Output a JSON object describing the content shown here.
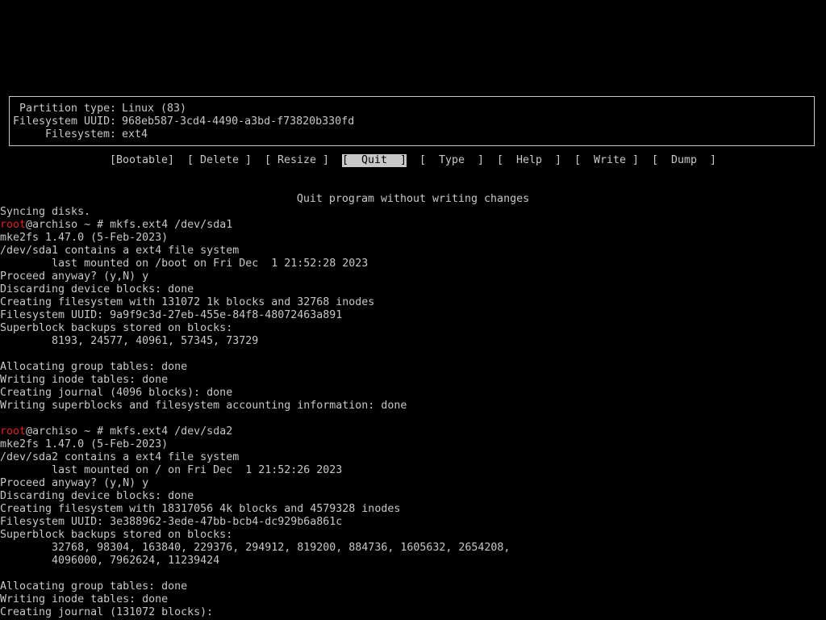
{
  "colors": {
    "background": "#000000",
    "text": "#c8c8c8",
    "prompt_user": "#e02020",
    "selected_bg": "#c8c8c8"
  },
  "partition_info": {
    "type_label": "Partition type:",
    "type_value": "Linux (83)",
    "uuid_label": "Filesystem UUID:",
    "uuid_value": "968eb587-3cd4-4490-a3bd-f73820b330fd",
    "fs_label": "Filesystem:",
    "fs_value": "ext4"
  },
  "menu": {
    "bootable": "[Bootable]",
    "delete": "[ Delete ]",
    "resize": "[ Resize ]",
    "quit": "[  Quit  ]",
    "type": "[  Type  ]",
    "help": "[  Help  ]",
    "write": "[  Write ]",
    "dump": "[  Dump  ]"
  },
  "status_message": "Quit program without writing changes",
  "terminal": {
    "l0": "Syncing disks.",
    "p1_user": "root",
    "p1_rest": "@archiso ~ # mkfs.ext4 /dev/sda1",
    "l2": "mke2fs 1.47.0 (5-Feb-2023)",
    "l3": "/dev/sda1 contains a ext4 file system",
    "l4": "        last mounted on /boot on Fri Dec  1 21:52:28 2023",
    "l5": "Proceed anyway? (y,N) y",
    "l6": "Discarding device blocks: done",
    "l7": "Creating filesystem with 131072 1k blocks and 32768 inodes",
    "l8": "Filesystem UUID: 9a9f9c3d-27eb-455e-84f8-48072463a891",
    "l9": "Superblock backups stored on blocks:",
    "l10": "        8193, 24577, 40961, 57345, 73729",
    "l12": "Allocating group tables: done",
    "l13": "Writing inode tables: done",
    "l14": "Creating journal (4096 blocks): done",
    "l15": "Writing superblocks and filesystem accounting information: done",
    "p2_user": "root",
    "p2_rest": "@archiso ~ # mkfs.ext4 /dev/sda2",
    "l18": "mke2fs 1.47.0 (5-Feb-2023)",
    "l19": "/dev/sda2 contains a ext4 file system",
    "l20": "        last mounted on / on Fri Dec  1 21:52:26 2023",
    "l21": "Proceed anyway? (y,N) y",
    "l22": "Discarding device blocks: done",
    "l23": "Creating filesystem with 18317056 4k blocks and 4579328 inodes",
    "l24": "Filesystem UUID: 3e388962-3ede-47bb-bcb4-dc929b6a861c",
    "l25": "Superblock backups stored on blocks:",
    "l26": "        32768, 98304, 163840, 229376, 294912, 819200, 884736, 1605632, 2654208,",
    "l27": "        4096000, 7962624, 11239424",
    "l29": "Allocating group tables: done",
    "l30": "Writing inode tables: done",
    "l31": "Creating journal (131072 blocks):"
  }
}
